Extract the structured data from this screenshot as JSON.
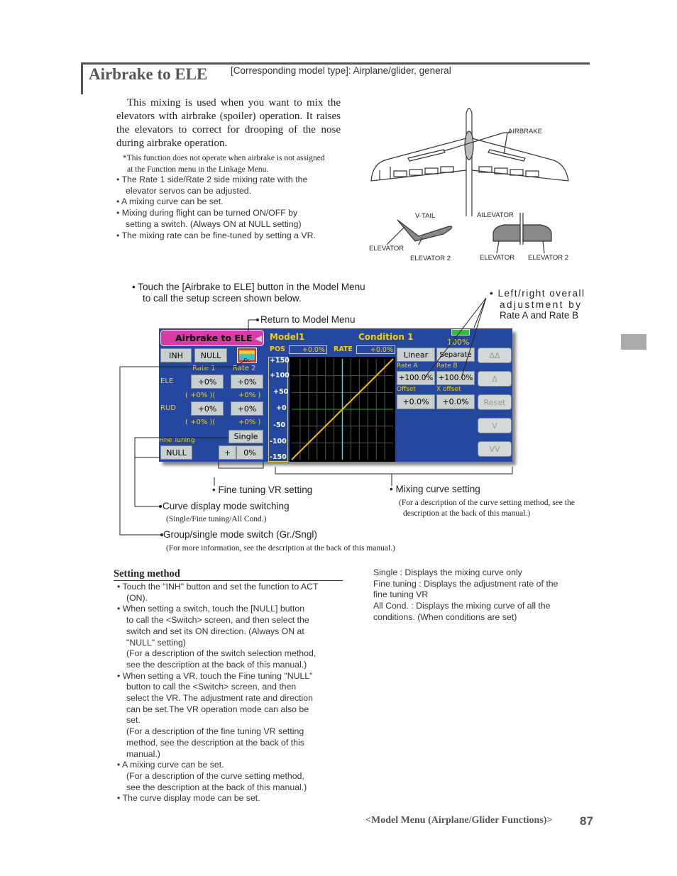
{
  "header": {
    "title": "Airbrake to ELE",
    "model_type": "[Corresponding model type]: Airplane/glider, general"
  },
  "intro": {
    "paragraph": "This mixing is used when you want to mix the elevators with airbrake (spoiler) operation. It raises the elevators to correct for drooping of the nose during airbrake operation.",
    "note_line1": "*This function does not operate when airbrake is not assigned",
    "note_line2": "at the Function menu in the Linkage Menu.",
    "bullets": [
      "• The Rate 1 side/Rate 2 side mixing rate with the",
      "elevator servos can be adjusted.",
      "• A mixing curve can be set.",
      "• Mixing during flight can be turned ON/OFF by",
      "setting a switch. (Always ON at NULL setting)",
      "• The mixing rate can be fine-tuned by setting a VR."
    ]
  },
  "diagram": {
    "airbrake": "AIRBRAKE",
    "vtail": "V-TAIL",
    "ailevator": "AILEVATOR",
    "elevator": "ELEVATOR",
    "elevator2": "ELEVATOR 2"
  },
  "instructions": {
    "line1": "• Touch the [Airbrake to ELE] button in the Model Menu",
    "line2": "to call the setup screen shown below."
  },
  "annotations": {
    "return": "Return to Model Menu",
    "rate_ab_1": "Left/right overall",
    "rate_ab_2": "adjustment by",
    "rate_ab_3": "Rate A and Rate B",
    "fine_vr": "• Fine tuning VR setting",
    "curve": "• Mixing curve setting",
    "curve_note1": "(For a description of the curve setting method, see the",
    "curve_note2": "description at the back of this manual.)",
    "curve_mode": "Curve display mode switching",
    "curve_mode_note": "(Single/Fine tuning/All Cond.)",
    "group": "Group/single mode switch (Gr./Sngl)",
    "group_note": "(For more information, see the description at the back of this manual.)"
  },
  "screen": {
    "title": "Airbrake to ELE",
    "model": "Model1",
    "condition": "Condition 1",
    "battery": "100%",
    "inh": "INH",
    "null": "NULL",
    "group_icon": "Gr.",
    "rate1": "Rate 1",
    "rate2": "Rate 2",
    "ele": "ELE",
    "rud": "RUD",
    "ele_r1": "+0%",
    "ele_r2": "+0%",
    "ele_p1": "(   +0% )(",
    "ele_p2": "+0% )",
    "rud_r1": "+0%",
    "rud_r2": "+0%",
    "rud_p1": "(   +0% )(",
    "rud_p2": "+0% )",
    "single": "Single",
    "fine_tuning": "Fine Tuning",
    "ft_null": "NULL",
    "ft_sign": "+",
    "ft_val": "0%",
    "pos_label": "POS",
    "pos": "+0.0%",
    "rate_label": "RATE",
    "rate": "+0.0%",
    "y_ticks": [
      "+150",
      "+100",
      "+50",
      "+0",
      "-50",
      "-100",
      "-150"
    ],
    "linear": "Linear",
    "separate": "Separate",
    "rate_a_label": "Rate A",
    "rate_b_label": "Rate B",
    "rate_a": "+100.0%",
    "rate_b": "+100.0%",
    "offset_label": "Offset",
    "xoffset_label": "X offset",
    "offset": "+0.0%",
    "xoffset": "+0.0%",
    "nav": [
      "ΔΔ",
      "Δ",
      "Reset",
      "V",
      "VV"
    ]
  },
  "setting": {
    "heading": "Setting method",
    "lines": [
      "• Touch the \"INH\" button and set the function to ACT",
      "(ON).",
      "• When setting a switch, touch the [NULL] button",
      "to call the <Switch> screen, and then select the",
      "switch and set its ON direction. (Always ON at",
      "\"NULL\" setting)",
      "(For a description of the switch selection method,",
      "see the description at the back of this manual.)",
      "• When setting a VR, touch the Fine tuning \"NULL\"",
      "button to call the <Switch> screen, and then",
      "select the VR. The adjustment rate and direction",
      "can be set.The VR operation mode can also be",
      "set.",
      "(For a description of the fine tuning VR setting",
      "method, see the description at the back of this",
      "manual.)",
      "• A mixing curve can be set.",
      "(For a description of the curve setting method,",
      "see the description at the back of this manual.)",
      "• The curve display mode can be set."
    ],
    "modes": [
      "Single : Displays the mixing curve only",
      "Fine tuning : Displays the adjustment rate of the",
      "fine  tuning VR",
      "All Cond. : Displays the mixing curve of all the",
      "conditions. (When conditions are set)"
    ]
  },
  "footer": {
    "section": "<Model Menu (Airplane/Glider Functions)>",
    "page": "87"
  }
}
